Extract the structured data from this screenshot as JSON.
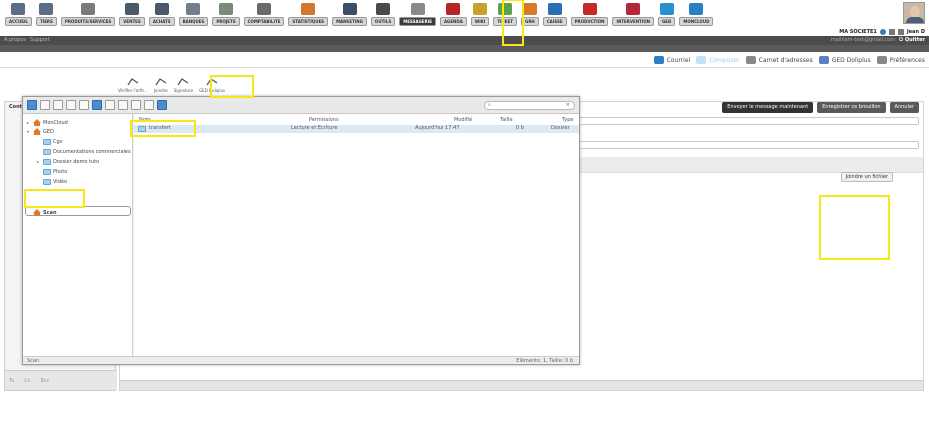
{
  "modules": [
    {
      "label": "ACCUEIL",
      "icon": "home-icon",
      "color": "#5a6f86"
    },
    {
      "label": "TIERS",
      "icon": "building-icon",
      "color": "#5a6f86"
    },
    {
      "label": "PRODUITS/SERVICES",
      "icon": "product-icon",
      "color": "#7a7a7a"
    },
    {
      "label": "VENTES",
      "icon": "sales-icon",
      "color": "#4a5a6a"
    },
    {
      "label": "ACHATS",
      "icon": "cart-icon",
      "color": "#4a5a6a"
    },
    {
      "label": "BANQUES",
      "icon": "bank-icon",
      "color": "#6f7f8f"
    },
    {
      "label": "PROJETS",
      "icon": "projects-icon",
      "color": "#7a8a7a"
    },
    {
      "label": "COMPTABILITE",
      "icon": "accounting-icon",
      "color": "#6a6a6a"
    },
    {
      "label": "STATISTIQUES",
      "icon": "pie-chart-icon",
      "color": "#d6762a"
    },
    {
      "label": "MARKETING",
      "icon": "marketing-icon",
      "color": "#3a4f66"
    },
    {
      "label": "OUTILS",
      "icon": "tools-icon",
      "color": "#4a4a4a"
    },
    {
      "label": "MESSAGERIE",
      "icon": "mail-icon",
      "color": "#8a8a8a",
      "active": true
    },
    {
      "label": "AGENDA",
      "icon": "calendar-icon",
      "color": "#b52626"
    },
    {
      "label": "WIKI",
      "icon": "wiki-icon",
      "color": "#c9a12a"
    },
    {
      "label": "TICKET",
      "icon": "ticket-icon",
      "color": "#5aa34a"
    },
    {
      "label": "GRH",
      "icon": "hr-icon",
      "color": "#d97a2a"
    },
    {
      "label": "CAISSE",
      "icon": "cash-register-icon",
      "color": "#2a6fb5"
    },
    {
      "label": "PRODUCTION",
      "icon": "production-icon",
      "color": "#c52a2a"
    },
    {
      "label": "INTERVENTION",
      "icon": "intervention-icon",
      "color": "#b5263a"
    },
    {
      "label": "GED",
      "icon": "folder-icon",
      "color": "#2a8fd0"
    },
    {
      "label": "MONCLOUD",
      "icon": "cloud-icon",
      "color": "#2a7fc5"
    }
  ],
  "user": {
    "company": "MA SOCIETE1",
    "name": "Jean D"
  },
  "topbar": {
    "left_links": [
      "A propos",
      "Support"
    ],
    "email": "mailnam-test@gmail.com",
    "quit": "Quitter"
  },
  "mail_actions": [
    {
      "label": "Courriel",
      "icon": "envelope-icon",
      "color": "#2a7fc5"
    },
    {
      "label": "Composer",
      "icon": "compose-icon",
      "color": "#bfe3f6",
      "dim": true
    },
    {
      "label": "Carnet d'adresses",
      "icon": "address-book-icon",
      "color": "#888888"
    },
    {
      "label": "GED Doliplus",
      "icon": "ged-icon",
      "color": "#5a7fc5"
    },
    {
      "label": "Préférences",
      "icon": "settings-icon",
      "color": "#888888"
    }
  ],
  "composer_tools": [
    {
      "label": "Vérifier l'orth...",
      "icon": "spellcheck-icon"
    },
    {
      "label": "Joindre",
      "icon": "paperclip-icon"
    },
    {
      "label": "Signature",
      "icon": "signature-icon"
    },
    {
      "label": "GED Doliplus",
      "icon": "ged-icon"
    }
  ],
  "left_panel": {
    "title": "Cont",
    "bottom_tabs": [
      "To",
      "Cc",
      "Bcc"
    ]
  },
  "compose": {
    "send_now": "Envoyer le message maintenant",
    "save_draft": "Enregistrer ce brouillon",
    "cancel": "Annuler",
    "attach_file": "Joindre un fichier"
  },
  "file_dialog": {
    "tree": [
      {
        "label": "MonCloud",
        "depth": 0,
        "icon": "home-icon",
        "expandable": true
      },
      {
        "label": "GED",
        "depth": 0,
        "icon": "home-icon",
        "expandable": true,
        "expanded": true
      },
      {
        "label": "Cgv",
        "depth": 1,
        "icon": "folder-icon"
      },
      {
        "label": "Documentations commerciales",
        "depth": 1,
        "icon": "folder-icon"
      },
      {
        "label": "Dossier demo tuto",
        "depth": 1,
        "icon": "folder-icon",
        "expandable": true
      },
      {
        "label": "Photo",
        "depth": 1,
        "icon": "folder-icon"
      },
      {
        "label": "Vidéo",
        "depth": 1,
        "icon": "folder-icon"
      },
      {
        "label": "Scan",
        "depth": 0,
        "icon": "home-icon",
        "selected": true
      }
    ],
    "columns": [
      "Nom",
      "Permissions",
      "Modifié",
      "Taille",
      "Type"
    ],
    "files": [
      {
        "name": "transfert",
        "permissions": "Lecture et Ecriture",
        "modified": "Aujourd'hui 17:47",
        "size": "0 b",
        "type": "Dossier"
      }
    ],
    "status_left": "Scan",
    "status_right": "Eléments: 1, Taille: 0 b"
  }
}
